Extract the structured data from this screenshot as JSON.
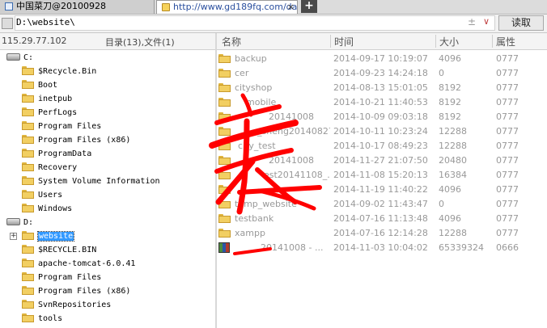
{
  "tabs": [
    {
      "title": "中国菜刀@20100928",
      "icon": "window-icon"
    },
    {
      "title": "http://www.gd189fq.com/dat",
      "icon": "folder-icon",
      "close": "×"
    }
  ],
  "new_tab_label": "+",
  "pathbar": {
    "path": "D:\\website\\",
    "pm_glyph": "±",
    "dropdown_glyph": "∨",
    "read_label": "读取"
  },
  "left_panel": {
    "ip": "115.29.77.102",
    "summary": "目录(13),文件(1)",
    "tree": [
      {
        "type": "drive",
        "label": "C:"
      },
      {
        "type": "folder",
        "label": "$Recycle.Bin"
      },
      {
        "type": "folder",
        "label": "Boot"
      },
      {
        "type": "folder",
        "label": "inetpub"
      },
      {
        "type": "folder",
        "label": "PerfLogs"
      },
      {
        "type": "folder",
        "label": "Program Files"
      },
      {
        "type": "folder",
        "label": "Program Files (x86)"
      },
      {
        "type": "folder",
        "label": "ProgramData"
      },
      {
        "type": "folder",
        "label": "Recovery"
      },
      {
        "type": "folder",
        "label": "System Volume Information"
      },
      {
        "type": "folder",
        "label": "Users"
      },
      {
        "type": "folder",
        "label": "Windows"
      },
      {
        "type": "drive",
        "label": "D:"
      },
      {
        "type": "folder",
        "label": "website",
        "selected": true,
        "expander": "+"
      },
      {
        "type": "folder",
        "label": "$RECYCLE.BIN"
      },
      {
        "type": "folder",
        "label": "apache-tomcat-6.0.41"
      },
      {
        "type": "folder",
        "label": "Program Files"
      },
      {
        "type": "folder",
        "label": "Program Files (x86)"
      },
      {
        "type": "folder",
        "label": "SvnRepositories"
      },
      {
        "type": "folder",
        "label": "tools"
      }
    ]
  },
  "file_list": {
    "columns": [
      "名称",
      "时间",
      "大小",
      "属性"
    ],
    "rows": [
      {
        "name": "backup",
        "time": "2014-09-17 10:19:07",
        "size": "4096",
        "attr": "0777",
        "type": "folder"
      },
      {
        "name": "cer",
        "time": "2014-09-23 14:24:18",
        "size": "0",
        "attr": "0777",
        "type": "folder"
      },
      {
        "name": "cityshop",
        "time": "2014-08-13 15:01:05",
        "size": "8192",
        "attr": "0777",
        "type": "folder"
      },
      {
        "name": "mobile",
        "time": "2014-10-21 11:40:53",
        "size": "8192",
        "attr": "0777",
        "type": "folder"
      },
      {
        "name": "20141008",
        "time": "2014-10-09 09:03:18",
        "size": "8192",
        "attr": "0777",
        "type": "folder"
      },
      {
        "name": "_sheng20140827",
        "time": "2014-10-11 10:23:24",
        "size": "12288",
        "attr": "0777",
        "type": "folder"
      },
      {
        "name": "city_test",
        "time": "2014-10-17 08:49:23",
        "size": "12288",
        "attr": "0777",
        "type": "folder"
      },
      {
        "name": "20141008",
        "time": "2014-11-27 21:07:50",
        "size": "20480",
        "attr": "0777",
        "type": "folder"
      },
      {
        "name": "est20141108_...",
        "time": "2014-11-08 15:20:13",
        "size": "16384",
        "attr": "0777",
        "type": "folder"
      },
      {
        "name": "",
        "time": "2014-11-19 11:40:22",
        "size": "4096",
        "attr": "0777",
        "type": "folder"
      },
      {
        "name": "temp_website",
        "time": "2014-09-02 11:43:47",
        "size": "0",
        "attr": "0777",
        "type": "folder"
      },
      {
        "name": "testbank",
        "time": "2014-07-16 11:13:48",
        "size": "4096",
        "attr": "0777",
        "type": "folder"
      },
      {
        "name": "xampp",
        "time": "2014-07-16 12:14:28",
        "size": "12288",
        "attr": "0777",
        "type": "folder"
      },
      {
        "name": "20141008 - ...",
        "time": "2014-11-03 10:04:02",
        "size": "65339324",
        "attr": "0666",
        "type": "archive"
      }
    ]
  },
  "colors": {
    "selection": "#3399ff",
    "annotation": "#ff0000",
    "folder": "#f2cf62"
  }
}
